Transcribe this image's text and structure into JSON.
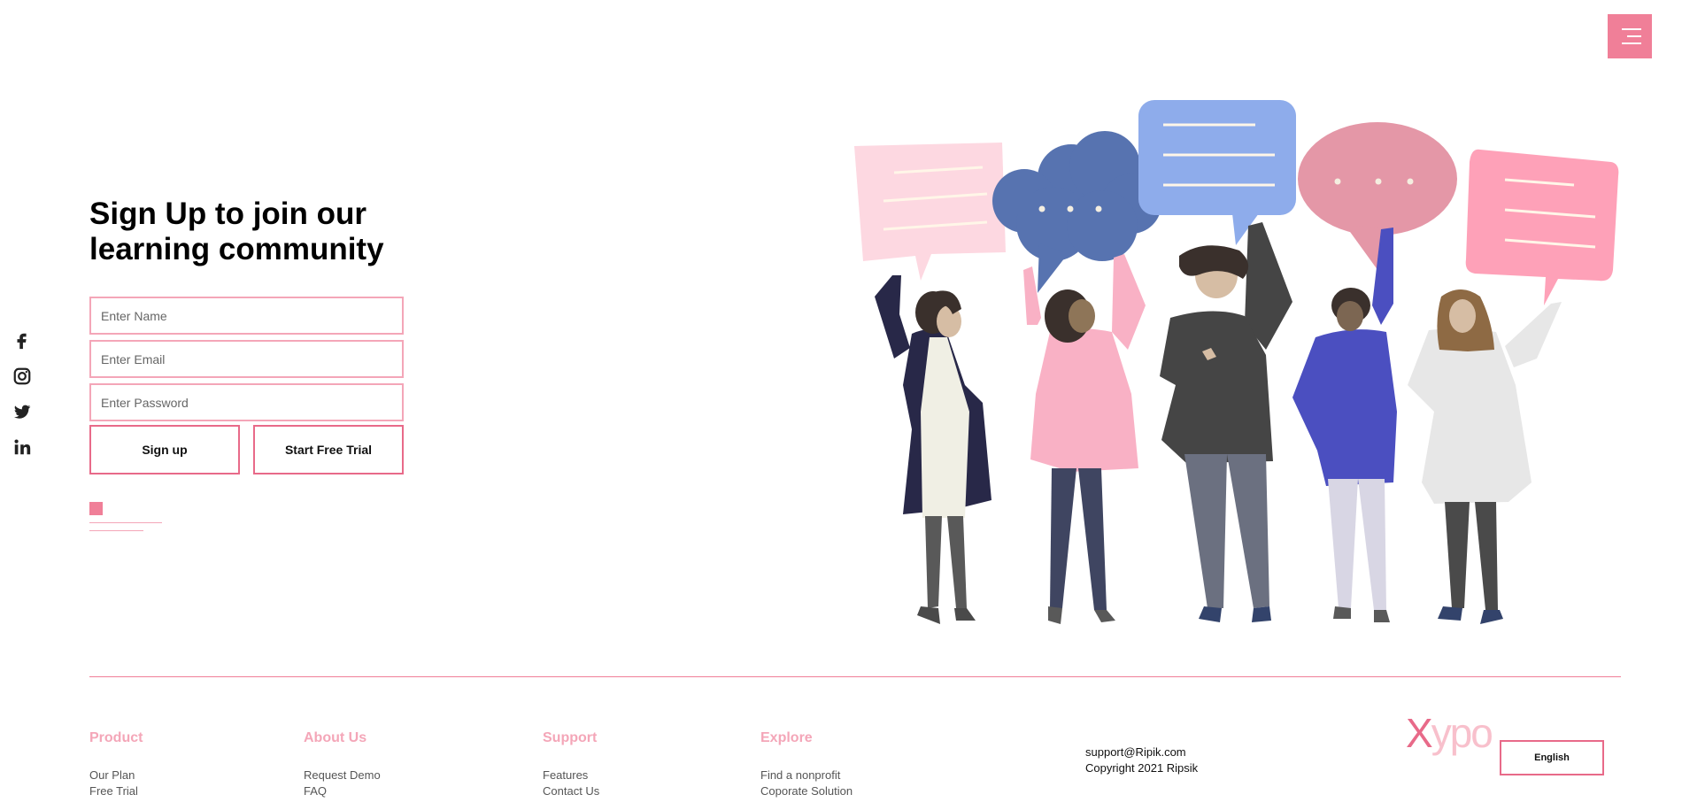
{
  "header": {
    "menu_icon": "hamburger-icon",
    "accent": "#f07f98"
  },
  "social": [
    {
      "icon": "facebook-icon"
    },
    {
      "icon": "instagram-icon"
    },
    {
      "icon": "twitter-icon"
    },
    {
      "icon": "linkedin-icon"
    }
  ],
  "signup": {
    "title": "Sign Up to join our\nlearning community",
    "name_placeholder": "Enter Name",
    "email_placeholder": "Enter Email",
    "password_placeholder": "Enter Password",
    "signup_label": "Sign up",
    "trial_label": "Start Free Trial"
  },
  "footer": {
    "columns": [
      {
        "heading": "Product",
        "links": [
          "Our Plan",
          "Free Trial"
        ]
      },
      {
        "heading": "About Us",
        "links": [
          "Request Demo",
          "FAQ"
        ]
      },
      {
        "heading": "Support",
        "links": [
          "Features",
          "Contact Us"
        ]
      },
      {
        "heading": "Explore",
        "links": [
          "Find a nonprofit",
          "Coporate Solution"
        ]
      }
    ],
    "email": "support@Ripik.com",
    "copyright": "Copyright 2021 Ripsik",
    "logo_x": "X",
    "logo_rest": "ypo",
    "language_label": "English"
  }
}
